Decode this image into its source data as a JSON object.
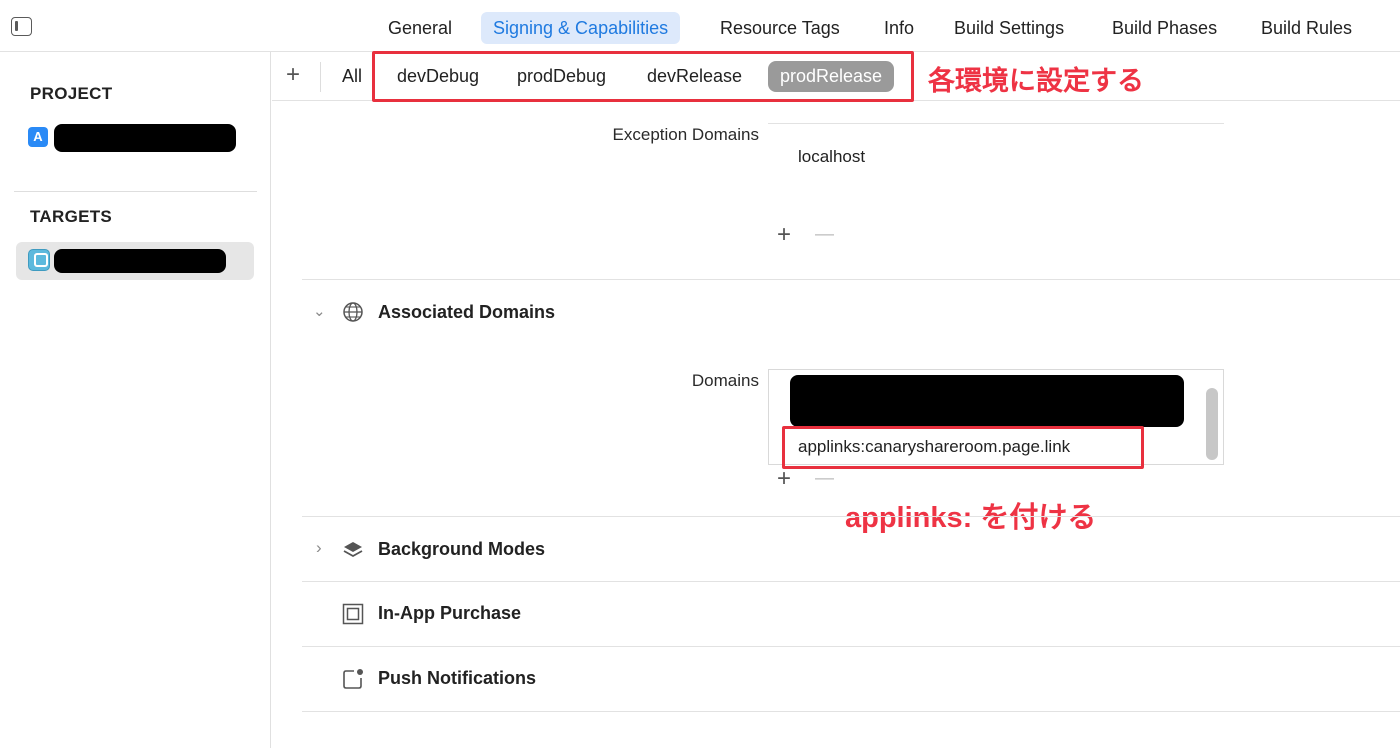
{
  "top_tabs": [
    {
      "label": "General",
      "active": false
    },
    {
      "label": "Signing & Capabilities",
      "active": true
    },
    {
      "label": "Resource Tags",
      "active": false
    },
    {
      "label": "Info",
      "active": false
    },
    {
      "label": "Build Settings",
      "active": false
    },
    {
      "label": "Build Phases",
      "active": false
    },
    {
      "label": "Build Rules",
      "active": false
    }
  ],
  "sidebar": {
    "project_heading": "PROJECT",
    "targets_heading": "TARGETS"
  },
  "config_bar": {
    "add_label": "+",
    "tabs": [
      {
        "label": "All",
        "active": false
      },
      {
        "label": "devDebug",
        "active": false
      },
      {
        "label": "prodDebug",
        "active": false
      },
      {
        "label": "devRelease",
        "active": false
      },
      {
        "label": "prodRelease",
        "active": true
      }
    ]
  },
  "annotations": {
    "config_note": "各環境に設定する",
    "domain_note": "applinks: を付ける"
  },
  "exception_domains": {
    "label": "Exception Domains",
    "items": [
      "localhost"
    ],
    "add_label": "+",
    "remove_label": "—"
  },
  "associated_domains": {
    "title": "Associated Domains",
    "domains_label": "Domains",
    "items": [
      "applinks:canaryshareroom.page.link"
    ],
    "add_label": "+",
    "remove_label": "—"
  },
  "capabilities": [
    {
      "title": "Background Modes",
      "icon": "stack-icon"
    },
    {
      "title": "In-App Purchase",
      "icon": "in-app-purchase-icon"
    },
    {
      "title": "Push Notifications",
      "icon": "push-notifications-icon"
    }
  ],
  "colors": {
    "accent": "#1f7ae0",
    "active_tab_bg": "#dde9fb",
    "active_config_bg": "#9a9a9a",
    "annotation_red": "#e8303e"
  }
}
